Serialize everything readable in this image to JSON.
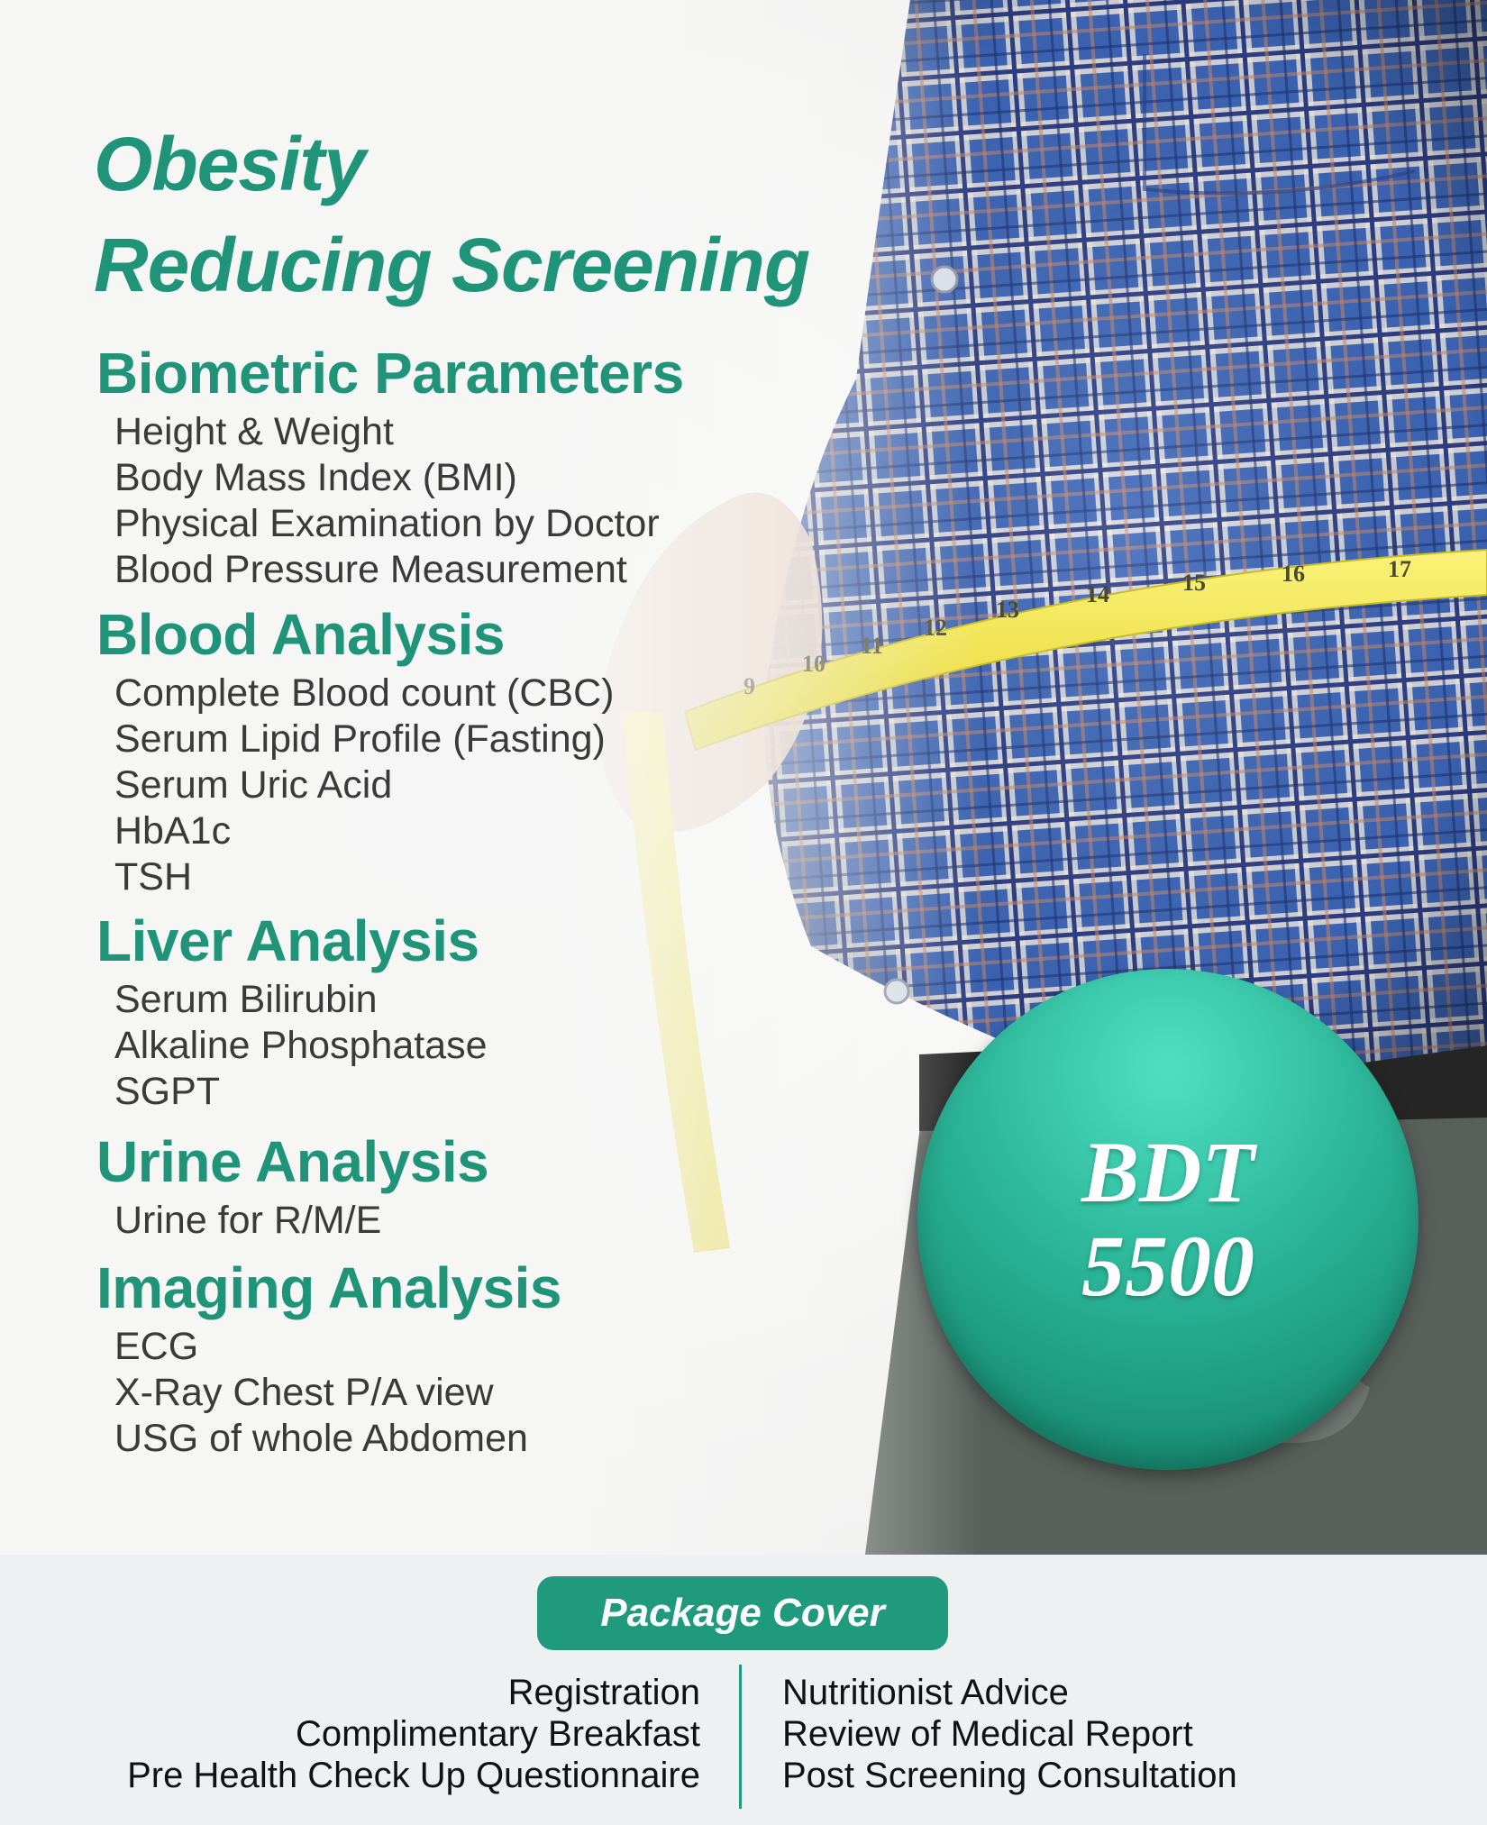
{
  "title": {
    "line1": "Obesity",
    "line2": "Reducing Screening"
  },
  "sections": [
    {
      "heading": "Biometric Parameters",
      "items": [
        "Height & Weight",
        "Body Mass Index (BMI)",
        "Physical Examination by Doctor",
        "Blood Pressure Measurement"
      ]
    },
    {
      "heading": "Blood Analysis",
      "items": [
        "Complete Blood count (CBC)",
        "Serum Lipid Profile (Fasting)",
        "Serum Uric Acid",
        "HbA1c",
        "TSH"
      ]
    },
    {
      "heading": "Liver Analysis",
      "items": [
        "Serum Bilirubin",
        "Alkaline Phosphatase",
        "SGPT"
      ]
    },
    {
      "heading": "Urine Analysis",
      "items": [
        "Urine for R/M/E"
      ]
    },
    {
      "heading": "Imaging Analysis",
      "items": [
        "ECG",
        "X-Ray Chest P/A view",
        "USG of whole Abdomen"
      ]
    }
  ],
  "price": {
    "currency": "BDT",
    "amount": "5500"
  },
  "package_cover": {
    "label": "Package Cover",
    "left_items": [
      "Registration",
      "Complimentary Breakfast",
      "Pre Health Check Up Questionnaire"
    ],
    "right_items": [
      "Nutritionist Advice",
      "Review of Medical Report",
      "Post Screening Consultation"
    ]
  },
  "tape_numbers": [
    "9",
    "10",
    "11",
    "12",
    "13",
    "14",
    "15",
    "16",
    "17"
  ],
  "colors": {
    "brand_green": "#1f9479",
    "shirt_blue": "#3f68b8",
    "tape_yellow": "#f2e84a"
  }
}
